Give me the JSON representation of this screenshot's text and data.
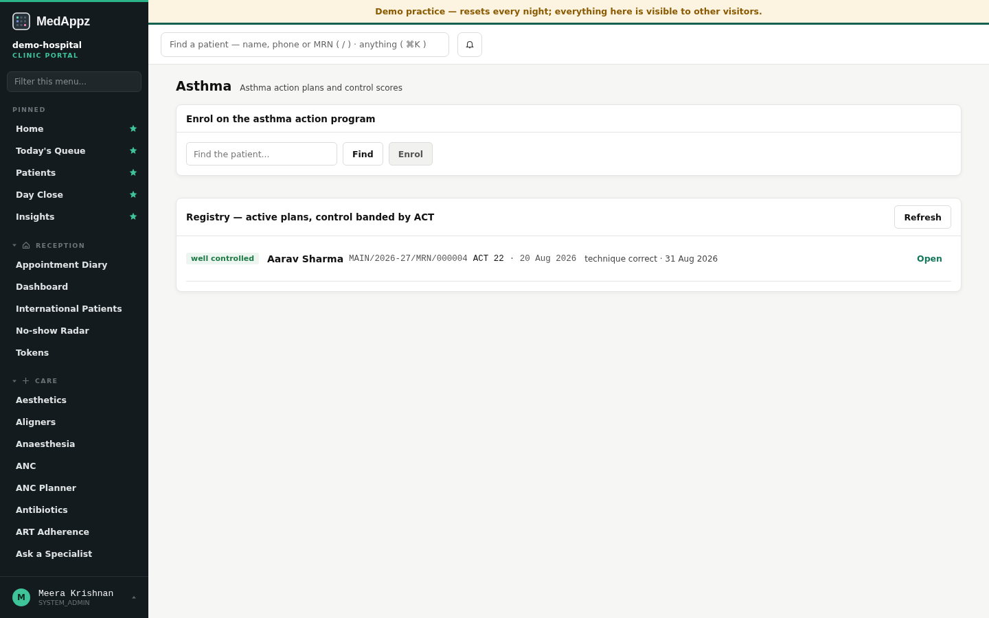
{
  "brand": {
    "name": "MedAppz",
    "org": "demo-hospital",
    "portal": "CLINIC PORTAL"
  },
  "sidebar": {
    "filter_placeholder": "Filter this menu...",
    "sections": [
      {
        "kind": "pinned",
        "title": "PINNED",
        "items": [
          {
            "label": "Home",
            "pinned": true
          },
          {
            "label": "Today's Queue",
            "pinned": true
          },
          {
            "label": "Patients",
            "pinned": true
          },
          {
            "label": "Day Close",
            "pinned": true
          },
          {
            "label": "Insights",
            "pinned": true
          }
        ]
      },
      {
        "kind": "reception",
        "title": "RECEPTION",
        "expanded": true,
        "items": [
          {
            "label": "Appointment Diary"
          },
          {
            "label": "Dashboard"
          },
          {
            "label": "International Patients"
          },
          {
            "label": "No-show Radar"
          },
          {
            "label": "Tokens"
          }
        ]
      },
      {
        "kind": "care",
        "title": "CARE",
        "expanded": true,
        "items": [
          {
            "label": "Aesthetics"
          },
          {
            "label": "Aligners"
          },
          {
            "label": "Anaesthesia"
          },
          {
            "label": "ANC"
          },
          {
            "label": "ANC Planner"
          },
          {
            "label": "Antibiotics"
          },
          {
            "label": "ART Adherence"
          },
          {
            "label": "Ask a Specialist"
          }
        ]
      }
    ],
    "user": {
      "initial": "M",
      "name": "Meera Krishnan",
      "role": "SYSTEM_ADMIN"
    }
  },
  "banner": "Demo practice — resets every night; everything here is visible to other visitors.",
  "topbar": {
    "search_placeholder": "Find a patient — name, phone or MRN ( / ) · anything ( ⌘K )"
  },
  "page": {
    "title": "Asthma",
    "subtitle": "Asthma action plans and control scores"
  },
  "enrol_card": {
    "title": "Enrol on the asthma action program",
    "placeholder": "Find the patient...",
    "find_button": "Find",
    "enrol_button": "Enrol",
    "enrol_disabled": true
  },
  "registry": {
    "title": "Registry — active plans, control banded by ACT",
    "refresh_button": "Refresh",
    "rows": [
      {
        "band": "well controlled",
        "color": "#1e7a46",
        "name": "Aarav Sharma",
        "mrn": "MAIN/2026-27/MRN/000004",
        "act": "ACT 22",
        "date": "· 20 Aug 2026",
        "technique": "technique correct · 31 Aug 2026",
        "action": "Open"
      }
    ]
  }
}
